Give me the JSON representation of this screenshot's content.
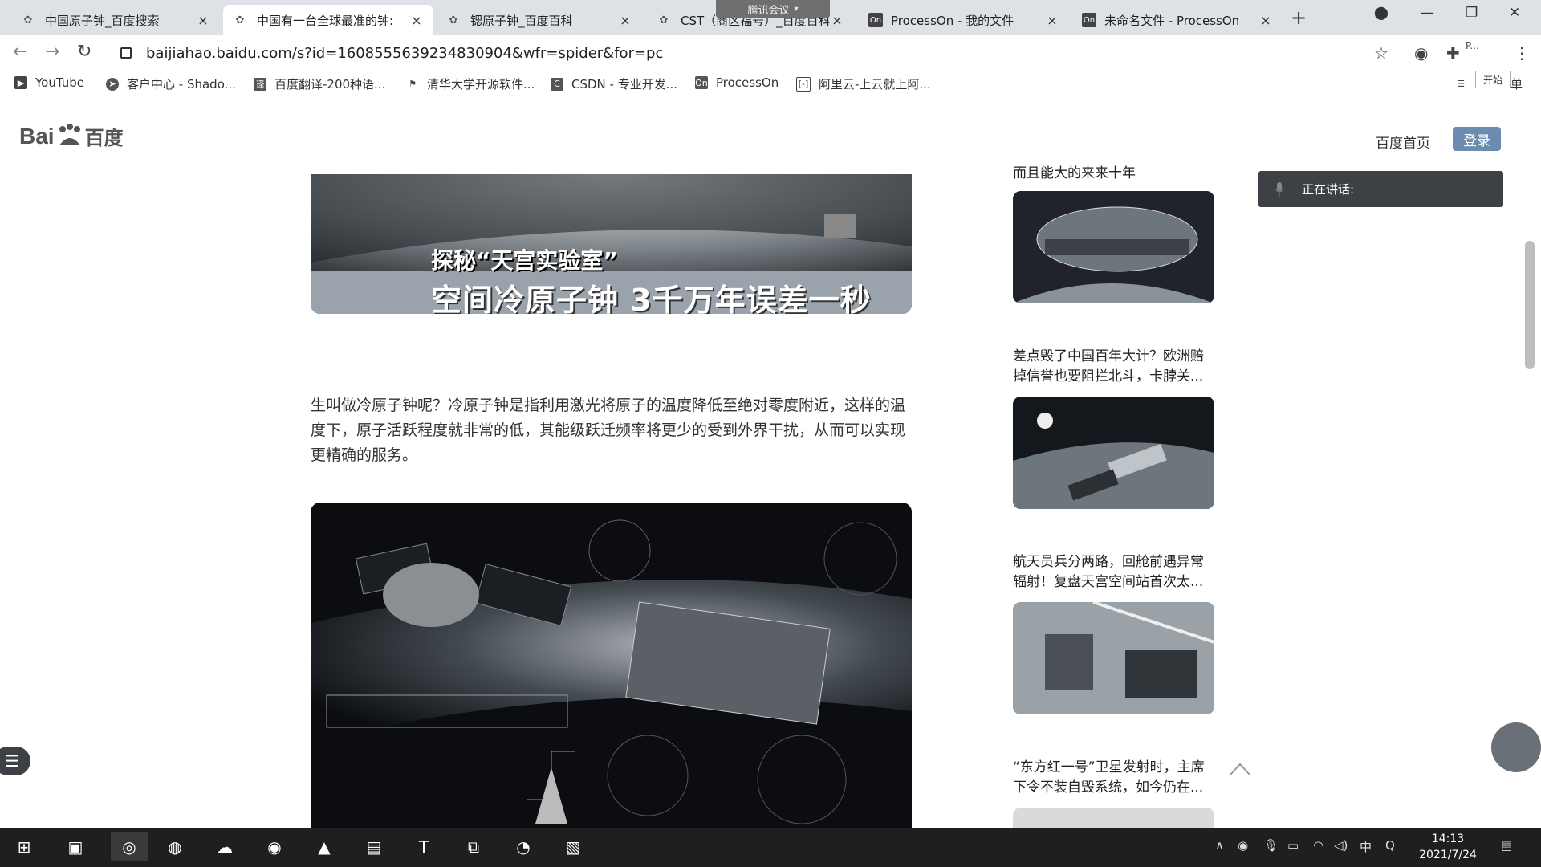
{
  "browser": {
    "tabs": [
      {
        "title": "中国原子钟_百度搜索",
        "icon": "baidu-paw-icon"
      },
      {
        "title": "中国有一台全球最准的钟:",
        "icon": "baidu-paw-icon"
      },
      {
        "title": "锶原子钟_百度百科",
        "icon": "baidu-paw-icon"
      },
      {
        "title": "CST（商区福号）_百度百科",
        "icon": "baidu-paw-icon"
      },
      {
        "title": "ProcessOn - 我的文件",
        "icon": "processon-icon"
      },
      {
        "title": "未命名文件 - ProcessOn",
        "icon": "processon-icon"
      }
    ],
    "processon_badge": "On",
    "meeting_label": "腾讯会议",
    "url": "baijiahao.baidu.com/s?id=1608555639234830904&wfr=spider&for=pc",
    "profile_label": "P...",
    "start_label": "开始",
    "side_label": "单"
  },
  "bookmarks": [
    {
      "label": "YouTube"
    },
    {
      "label": "客户中心 - Shado..."
    },
    {
      "label": "百度翻译-200种语..."
    },
    {
      "label": "清华大学开源软件..."
    },
    {
      "label": "CSDN - 专业开发..."
    },
    {
      "label": "ProcessOn"
    },
    {
      "label": "阿里云-上云就上阿..."
    }
  ],
  "page": {
    "logo_left": "Bai",
    "logo_mid": "du",
    "logo_right": "百度",
    "home_link": "百度首页",
    "login": "登录"
  },
  "article": {
    "hero_caption_1": "探秘“天宫实验室”",
    "hero_caption_2": "空间冷原子钟 3千万年误差一秒",
    "paragraph": "生叫做冷原子钟呢？冷原子钟是指利用激光将原子的温度降低至绝对零度附近，这样的温度下，原子活跃程度就非常的低，其能级跃迁频率将更少的受到外界干扰，从而可以实现更精确的服务。"
  },
  "sidebar": {
    "items": [
      {
        "title": "而且能大的来来十年"
      },
      {
        "title": "差点毁了中国百年大计？欧洲赔掉信誉也要阻拦北斗，卡脖关..."
      },
      {
        "title": "航天员兵分两路，回舱前遇异常辐射！复盘天宫空间站首次太..."
      },
      {
        "title": "“东方红一号”卫星发射时，主席下令不装自毁系统，如今仍在..."
      }
    ]
  },
  "meeting": {
    "speaking_label": "正在讲话:"
  },
  "taskbar": {
    "time": "14:13",
    "date": "2021/7/24",
    "ime": "中"
  }
}
